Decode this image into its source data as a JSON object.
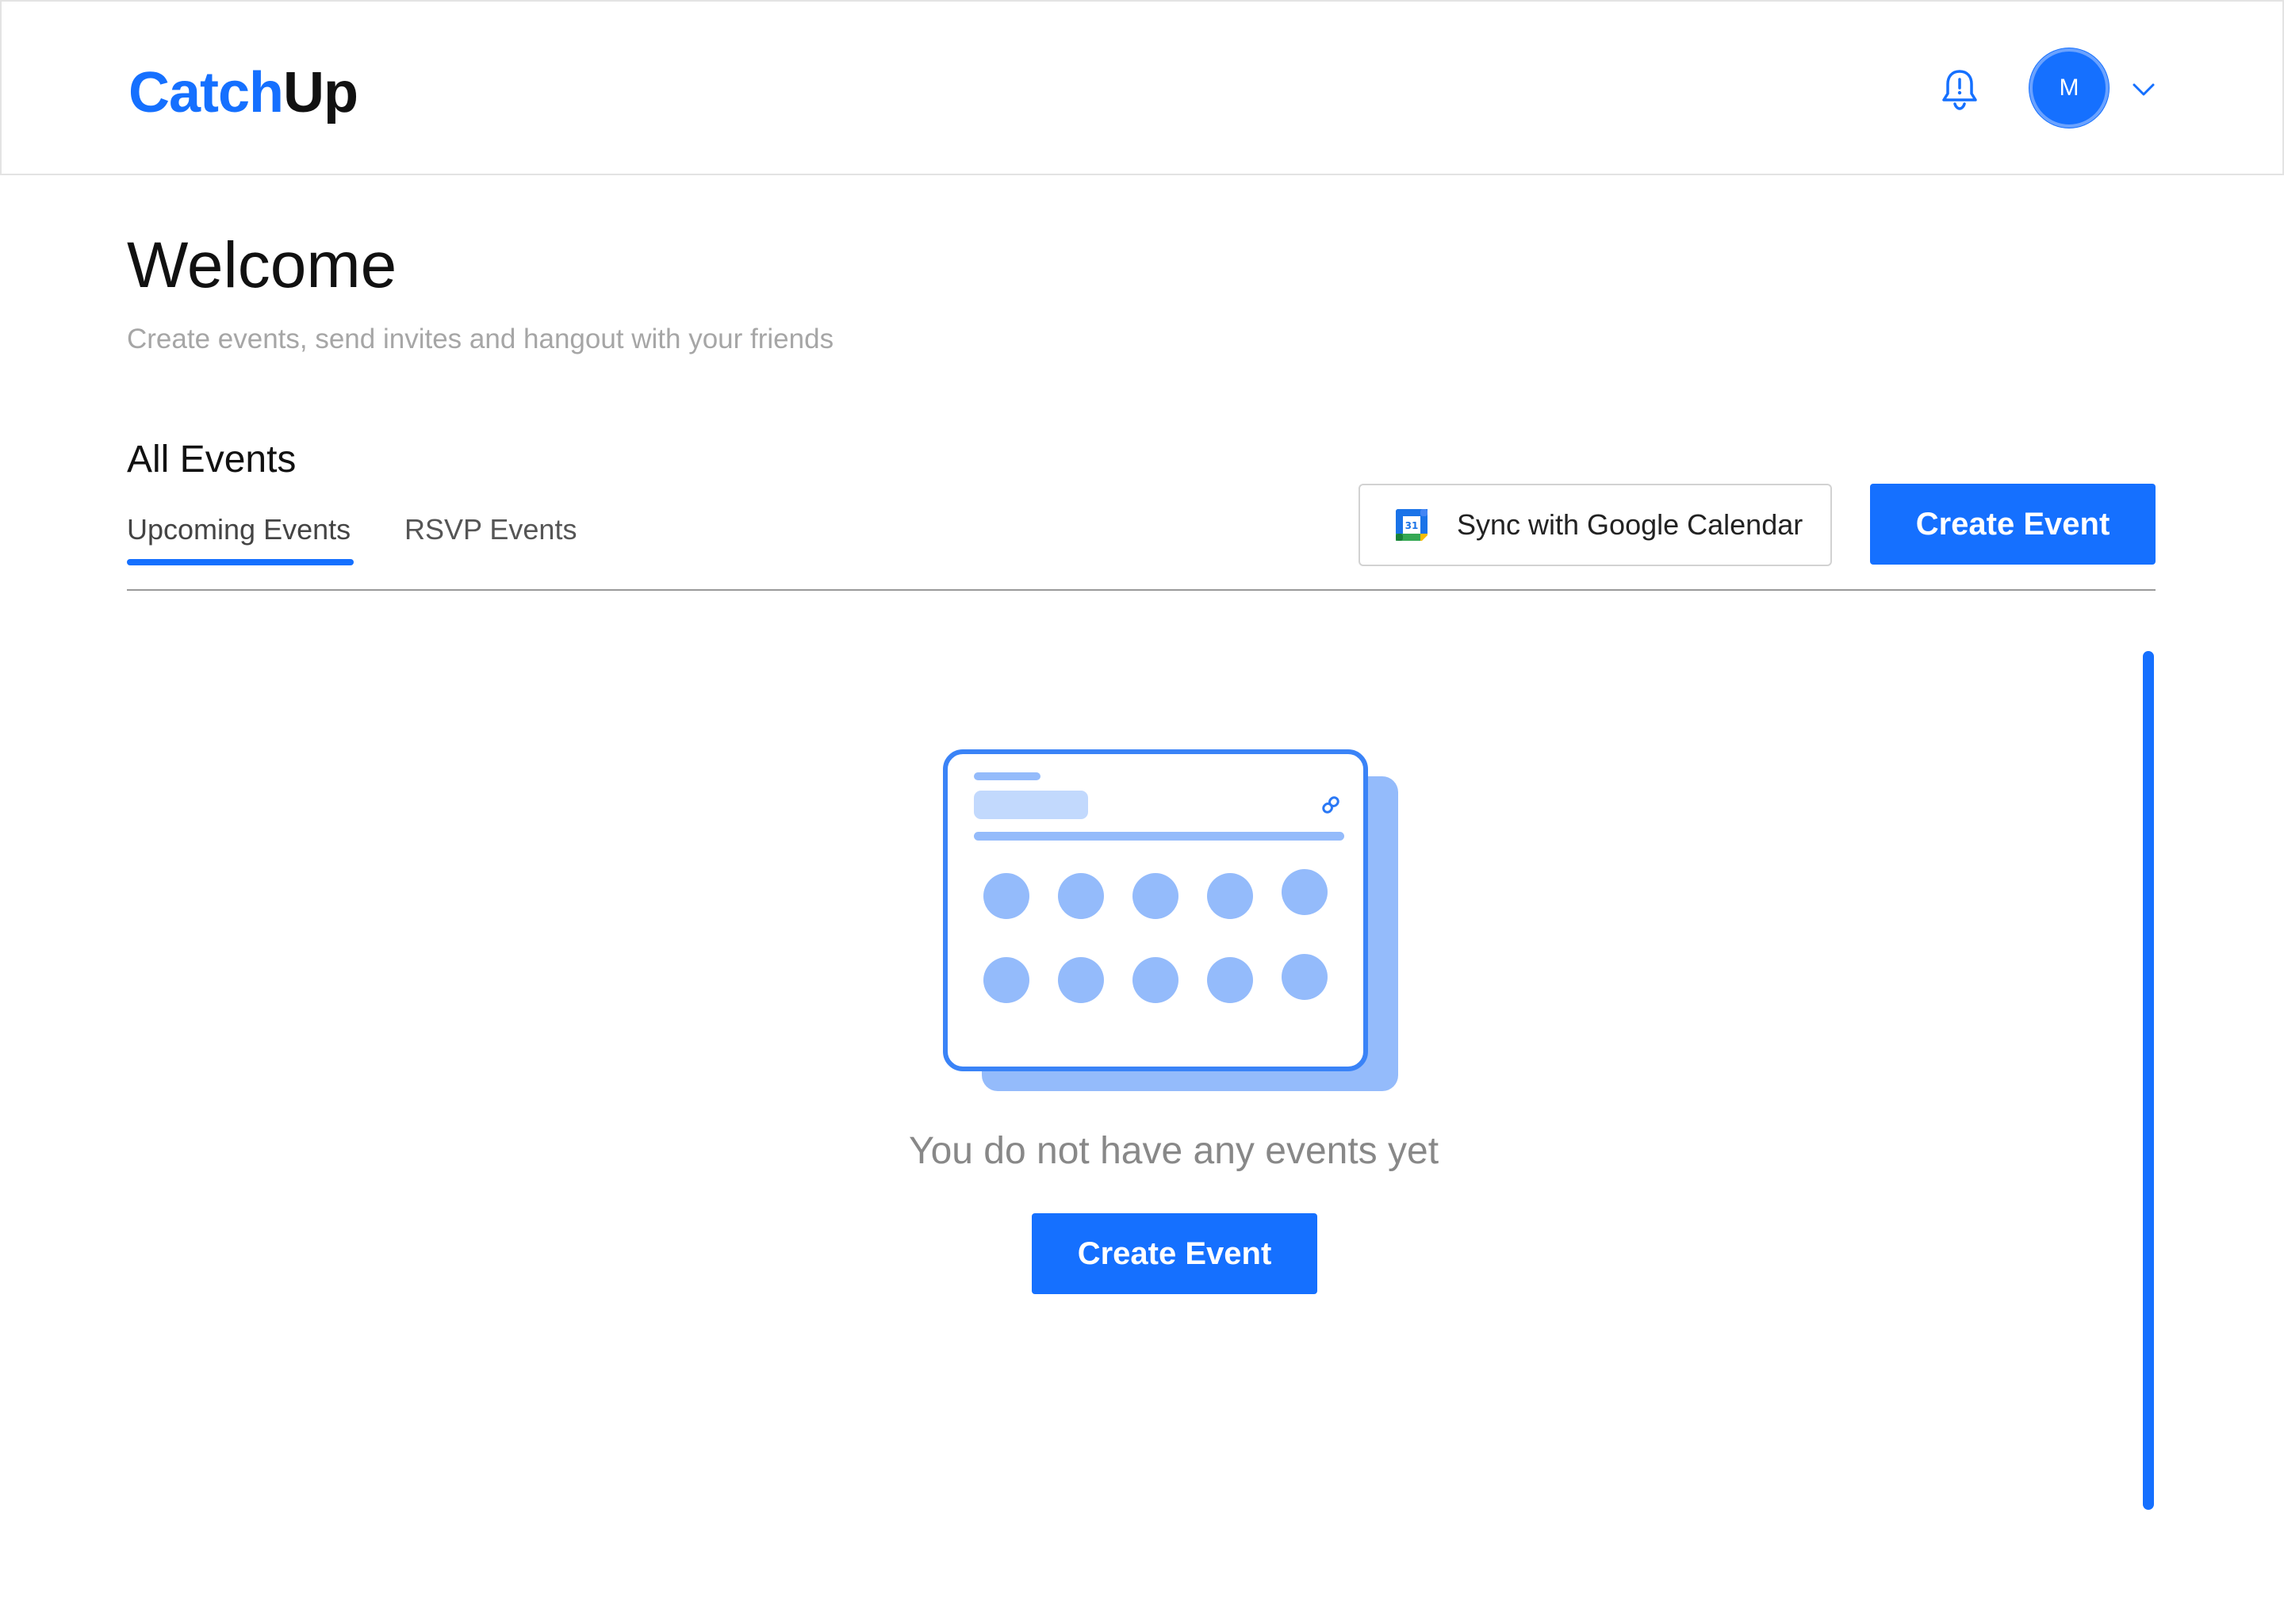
{
  "app": {
    "brand_part1": "Catch",
    "brand_part2": "Up",
    "accent_color": "#1570ff"
  },
  "header": {
    "notification_icon": "bell-icon",
    "avatar_initial": "M",
    "account_menu_icon": "chevron-down-icon"
  },
  "page": {
    "title": "Welcome",
    "subtitle": "Create events, send invites and hangout with your friends"
  },
  "events": {
    "section_title": "All Events",
    "tabs": [
      {
        "label": "Upcoming Events",
        "active": true
      },
      {
        "label": "RSVP Events",
        "active": false
      }
    ],
    "sync_button_label": "Sync with Google Calendar",
    "sync_icon": "google-calendar-icon",
    "create_button_label": "Create Event"
  },
  "empty_state": {
    "message": "You do not have any events yet",
    "create_button_label": "Create Event",
    "illustration": "calendar-illustration"
  }
}
